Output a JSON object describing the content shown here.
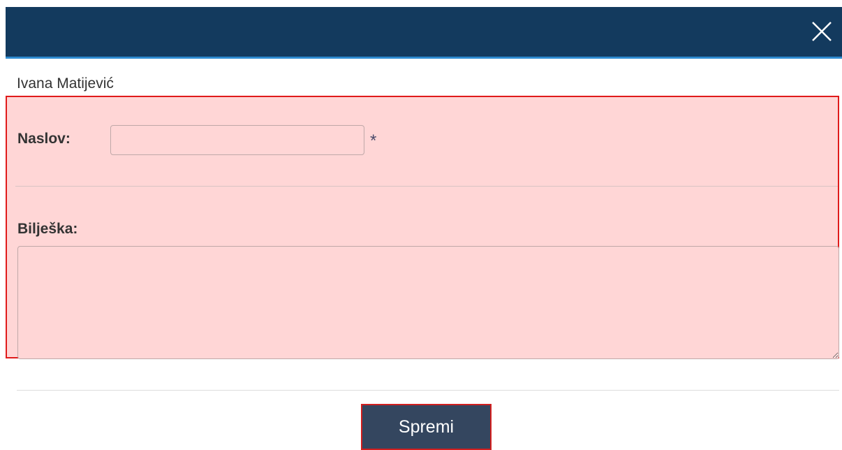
{
  "header": {
    "close_icon": "close-icon",
    "background_color": "#133a5e",
    "accent_border_color": "#2e8bd0"
  },
  "user": {
    "name": "Ivana Matijević"
  },
  "form": {
    "naslov_label": "Naslov:",
    "naslov_value": "",
    "required_marker": "*",
    "biljeska_label": "Bilješka:",
    "biljeska_value": "",
    "panel_background": "#ffd6d6",
    "panel_border_color": "#e01b1b"
  },
  "footer": {
    "save_label": "Spremi",
    "save_background": "#34465f"
  }
}
